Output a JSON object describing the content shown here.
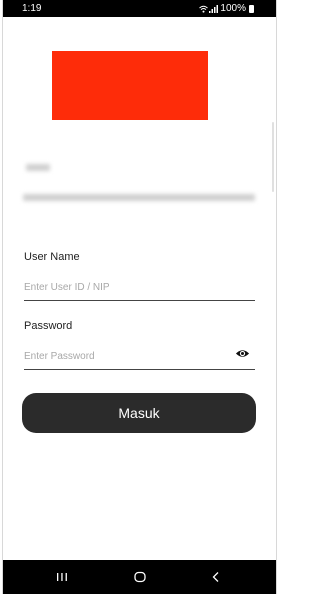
{
  "status_bar": {
    "time": "1:19",
    "battery": "100%",
    "icons": [
      "wifi-icon",
      "signal-icon",
      "battery-icon"
    ]
  },
  "logo": {
    "color": "#fe2c09"
  },
  "login_form": {
    "username": {
      "label": "User Name",
      "placeholder": "Enter User ID / NIP",
      "value": ""
    },
    "password": {
      "label": "Password",
      "placeholder": "Enter Password",
      "value": ""
    },
    "submit_label": "Masuk"
  },
  "navigation_bar": {
    "buttons": [
      "recent-apps-icon",
      "home-icon",
      "back-icon"
    ]
  }
}
